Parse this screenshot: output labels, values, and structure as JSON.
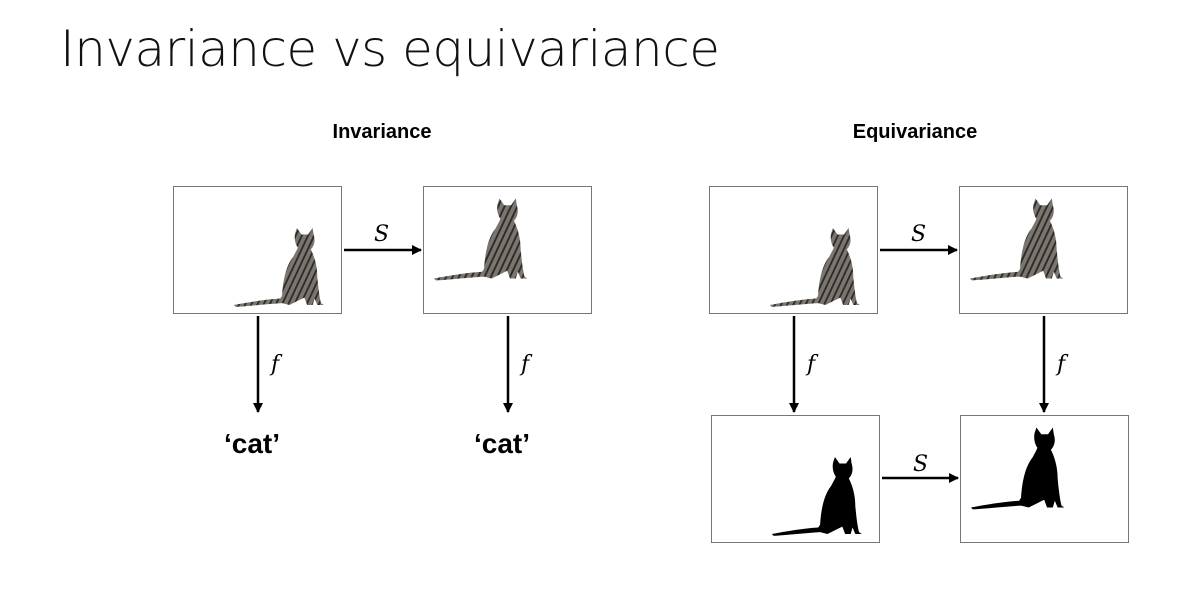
{
  "slide": {
    "title": "Invariance vs equivariance"
  },
  "invariance": {
    "heading": "Invariance",
    "transform_label": "S",
    "function_label_left": "f",
    "function_label_right": "f",
    "output_left": "‘cat’",
    "output_right": "‘cat’"
  },
  "equivariance": {
    "heading": "Equivariance",
    "transform_label_top": "S",
    "function_label_left": "f",
    "function_label_right": "f",
    "transform_label_bottom": "S"
  },
  "colors": {
    "arrow": "#000000",
    "frame_border": "#777777",
    "cat_body": "#6e6a64",
    "cat_stripes": "#2e2b28",
    "silhouette": "#000000"
  }
}
